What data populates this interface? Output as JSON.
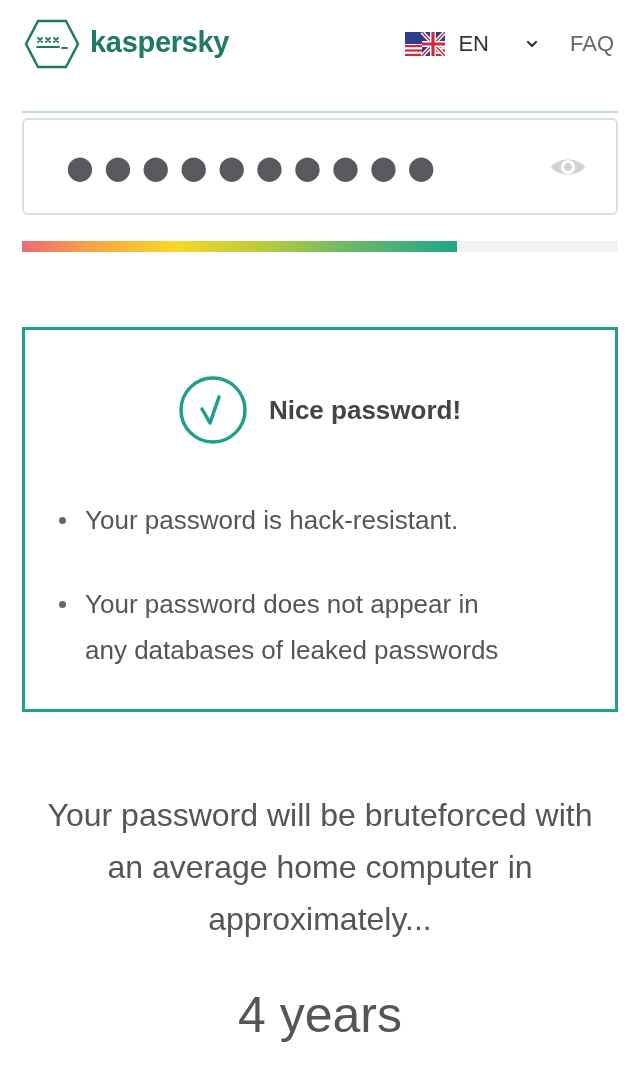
{
  "header": {
    "brand": "kaspersky",
    "language": {
      "code": "EN"
    },
    "faq": "FAQ"
  },
  "password_field": {
    "masked_value": "●●●●●●●●●●"
  },
  "strength_meter": {
    "level": 0.73
  },
  "result": {
    "title": "Nice password!",
    "points": [
      "Your password is hack-resistant.",
      "Your password does not appear in any databases of leaked passwords"
    ]
  },
  "estimate": {
    "text": "Your password will be bruteforced with an average home computer in approximately...",
    "duration": "4 years"
  }
}
